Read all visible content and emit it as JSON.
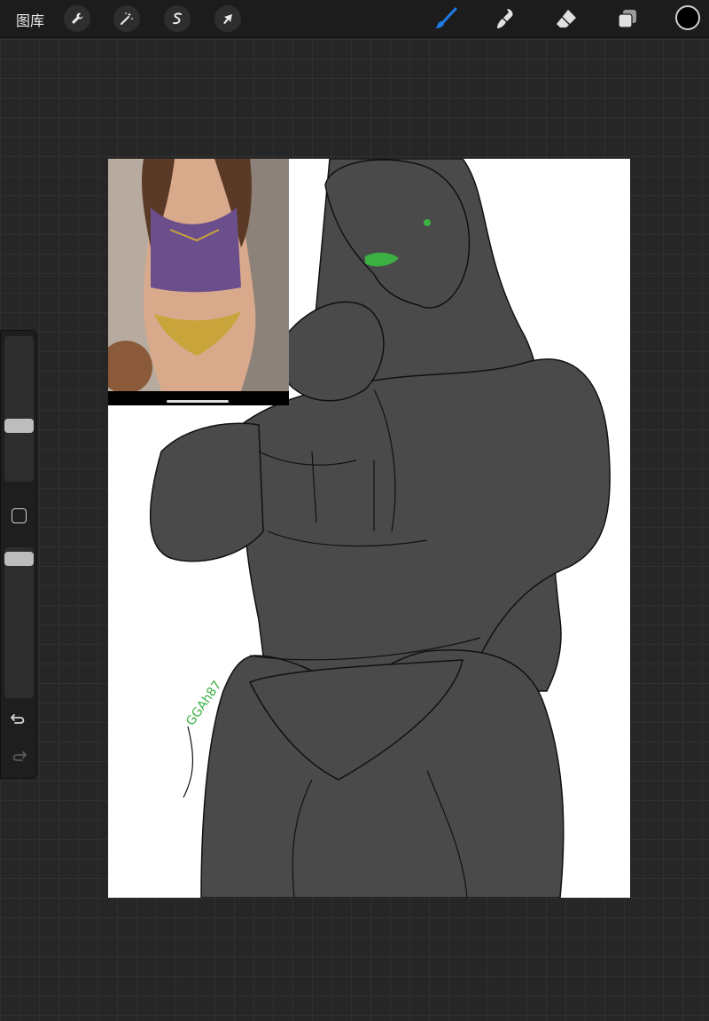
{
  "topbar": {
    "gallery_label": "图库",
    "left_tools": [
      {
        "icon": "wrench-icon",
        "name": "actions"
      },
      {
        "icon": "magic-wand-icon",
        "name": "adjustments"
      },
      {
        "icon": "selection-icon",
        "name": "selection"
      },
      {
        "icon": "arrow-cursor-icon",
        "name": "transform"
      }
    ],
    "right_tools": [
      {
        "icon": "brush-icon",
        "name": "paint",
        "active": true
      },
      {
        "icon": "smudge-icon",
        "name": "smudge"
      },
      {
        "icon": "eraser-icon",
        "name": "eraser"
      },
      {
        "icon": "layers-icon",
        "name": "layers"
      }
    ],
    "current_color": "#000000",
    "active_tool_color": "#1e7ce8"
  },
  "sidebar": {
    "brush_size_level": 0.25,
    "opacity_level": 1.0,
    "icons": [
      "modify-square-icon",
      "undo-icon",
      "redo-icon"
    ]
  },
  "canvas": {
    "background": "#ffffff",
    "figure_fill": "#4a4a4a",
    "accent_color": "#3cb043",
    "signature": "GGAh87"
  },
  "reference": {
    "top_color": "#6b4f8c",
    "bottom_color": "#c9a43a",
    "skin_color": "#d9a98c"
  }
}
